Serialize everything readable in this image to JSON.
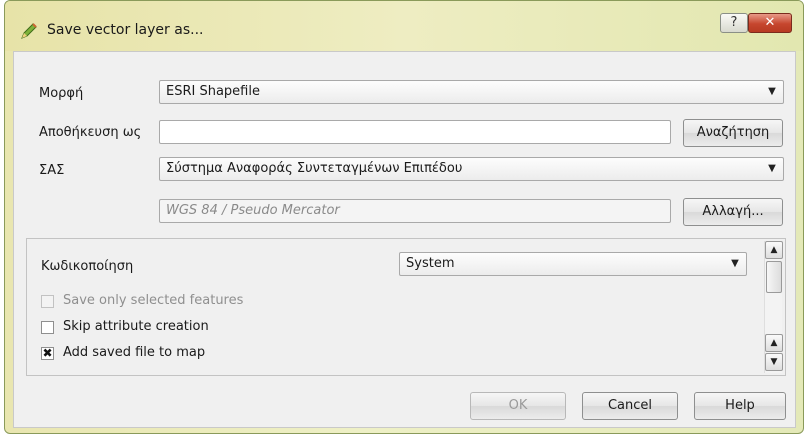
{
  "window": {
    "title": "Save vector layer as...",
    "help_glyph": "?",
    "close_glyph": "✕"
  },
  "form": {
    "format_label": "Μορφή",
    "format_value": "ESRI Shapefile",
    "save_as_label": "Αποθήκευση ως",
    "save_as_value": "",
    "browse_button": "Αναζήτηση",
    "crs_label": "ΣΑΣ",
    "crs_value": "Σύστημα Αναφοράς Συντεταγμένων Επιπέδου",
    "crs_name": "WGS 84 / Pseudo Mercator",
    "change_button": "Αλλαγή..."
  },
  "options": {
    "encoding_label": "Κωδικοποίηση",
    "encoding_value": "System",
    "checkboxes": [
      {
        "label": "Save only selected features",
        "checked": false,
        "enabled": false
      },
      {
        "label": "Skip attribute creation",
        "checked": false,
        "enabled": true
      },
      {
        "label": "Add saved file to map",
        "checked": true,
        "enabled": true
      }
    ]
  },
  "buttons": {
    "ok": "OK",
    "cancel": "Cancel",
    "help": "Help"
  },
  "icons": {
    "dropdown": "▼",
    "scroll_up": "▲",
    "scroll_down": "▼",
    "check": "✖"
  },
  "colors": {
    "titlebar": "#e9e6b0",
    "close_button": "#c6462e",
    "dialog_bg": "#f0f0f0"
  }
}
